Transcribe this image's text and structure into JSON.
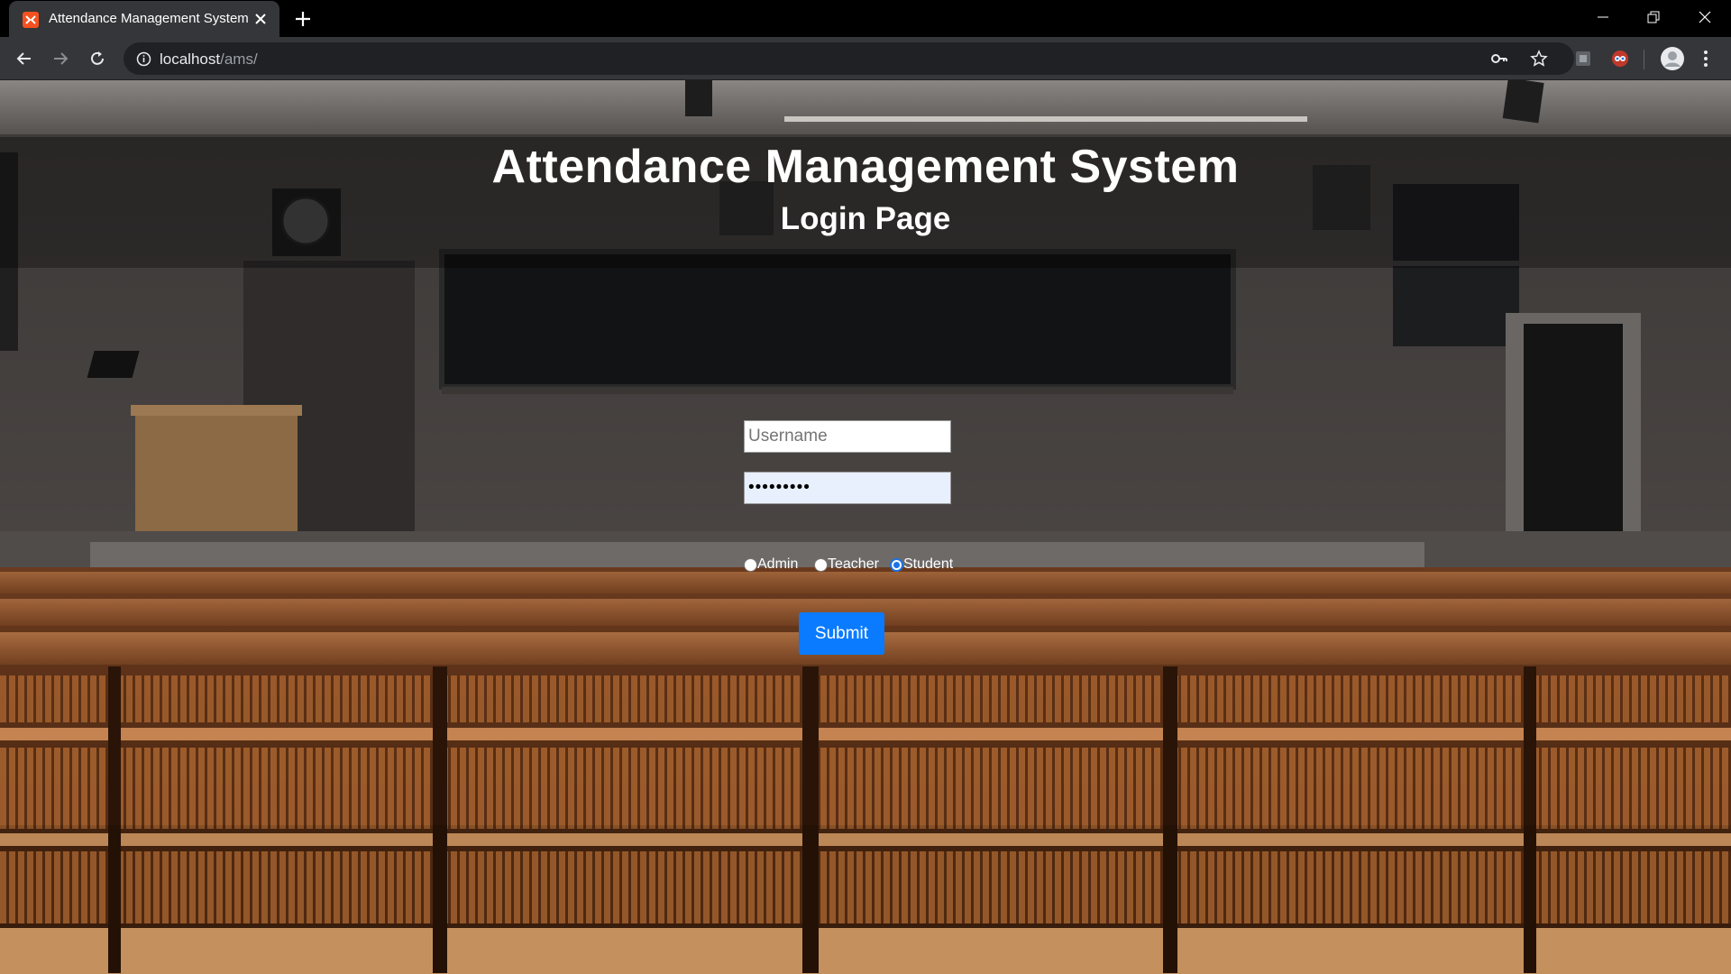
{
  "browser": {
    "tab_title": "Attendance Management System",
    "url_host": "localhost",
    "url_path": "/ams/"
  },
  "page": {
    "title": "Attendance Management System",
    "subtitle": "Login Page"
  },
  "form": {
    "username_placeholder": "Username",
    "username_value": "",
    "password_value": "•••••••••",
    "roles": [
      {
        "label": "Admin",
        "checked": false
      },
      {
        "label": "Teacher",
        "checked": false
      },
      {
        "label": "Student",
        "checked": true
      }
    ],
    "submit_label": "Submit"
  },
  "colors": {
    "submit_button": "#0a7bff",
    "chrome_toolbar": "#35363a",
    "chrome_titlebar": "#000000",
    "favicon": "#f4511e",
    "autofill_bg": "#e8f0fe"
  }
}
